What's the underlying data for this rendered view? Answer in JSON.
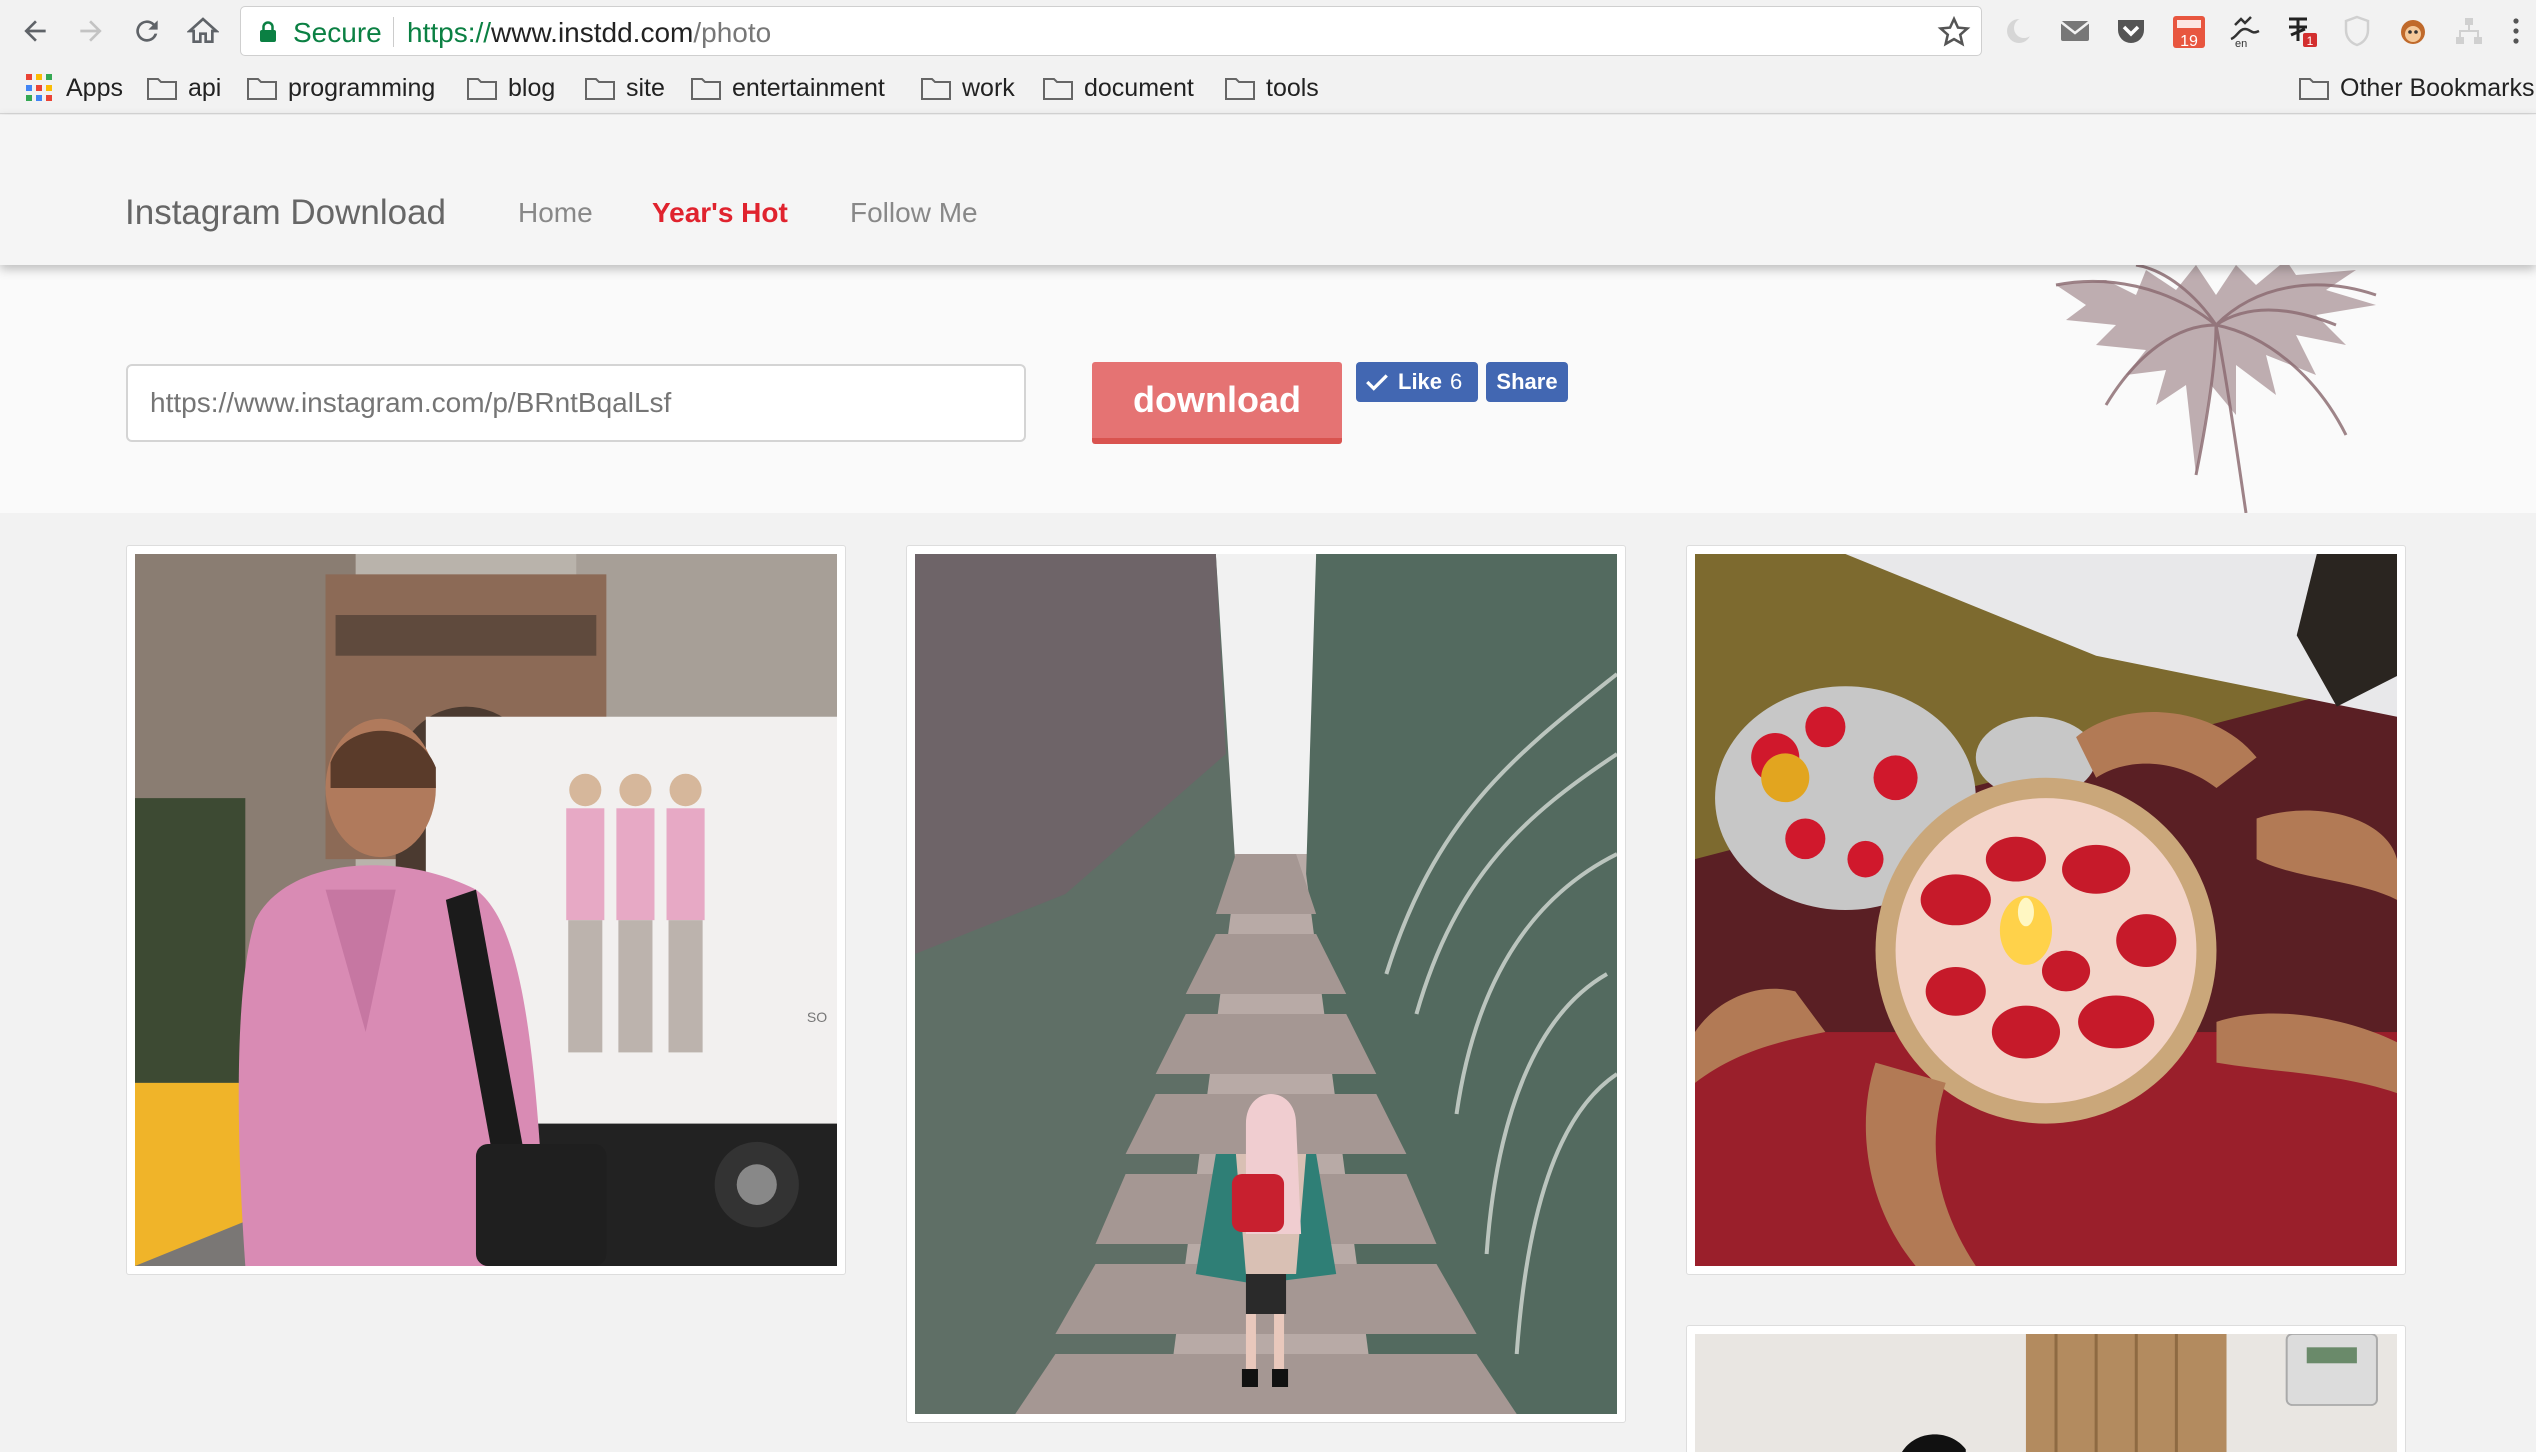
{
  "browser": {
    "secure_label": "Secure",
    "url_scheme": "https://",
    "url_host": "www.instdd.com",
    "url_path": "/photo",
    "extension_badges": {
      "calendar": "19",
      "chinese_ext": "1"
    },
    "icons": [
      "back-icon",
      "forward-icon",
      "reload-icon",
      "home-icon",
      "lock-icon",
      "star-icon",
      "menu-icon"
    ]
  },
  "bookmarks": {
    "apps": "Apps",
    "items": [
      "api",
      "programming",
      "blog",
      "site",
      "entertainment",
      "work",
      "document",
      "tools"
    ],
    "other": "Other Bookmarks"
  },
  "site": {
    "brand": "Instagram Download",
    "nav": [
      {
        "label": "Home",
        "active": false
      },
      {
        "label": "Year's Hot",
        "active": true
      },
      {
        "label": "Follow Me",
        "active": false
      }
    ],
    "accent_color": "#e0232e"
  },
  "form": {
    "placeholder": "https://www.instagram.com/p/BRntBqalLsf",
    "download_label": "download",
    "button_color": "#e57373"
  },
  "social": {
    "like_label": "Like",
    "like_count": "6",
    "share_label": "Share",
    "fb_color": "#4267b2"
  },
  "gallery": {
    "photos": [
      {
        "name": "photo-man-pink-shirt",
        "truck_text": "SO"
      },
      {
        "name": "photo-girl-stairs"
      },
      {
        "name": "photo-rose-petal-plate"
      },
      {
        "name": "photo-hospital-room"
      }
    ]
  }
}
